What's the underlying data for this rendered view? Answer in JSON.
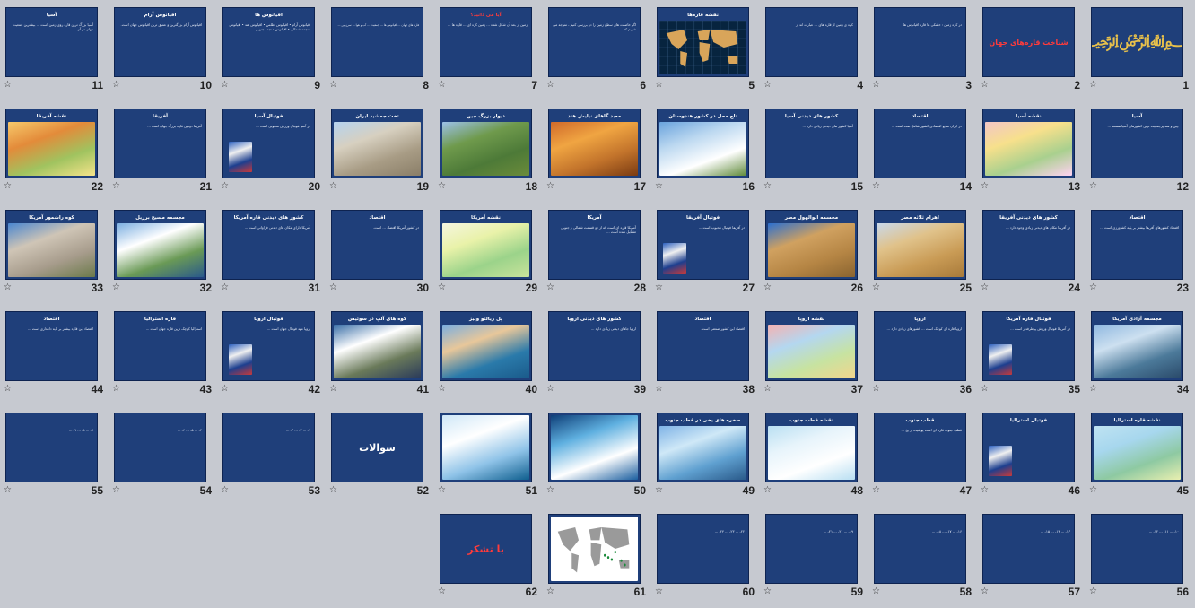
{
  "slides": [
    {
      "n": "1",
      "type": "calligraphy",
      "title": "بسم الله الرحمن الرحیم",
      "art": "gold-calligraphy"
    },
    {
      "n": "2",
      "type": "cover",
      "title": "شناخت قاره‌های جهان",
      "red": true
    },
    {
      "n": "3",
      "type": "text",
      "title": "",
      "body": "در کره زمین : خشکی ها قاره اقیانوس ها"
    },
    {
      "n": "4",
      "type": "text",
      "title": "",
      "body": "کره ی زمین از قاره های ... عبارت اند از"
    },
    {
      "n": "5",
      "type": "photo",
      "title": "نقشه قاره‌ها",
      "art": "world-map"
    },
    {
      "n": "6",
      "type": "text",
      "title": "",
      "red": true,
      "body": "اگر خاصیت های سطح زمین را در بررسی کنیم ، متوجه می شویم که ..."
    },
    {
      "n": "7",
      "type": "text",
      "title": "آیا می دانید؟",
      "red": true,
      "body": "زمین از بعد آن شکل شده ... زمین کره ای ... قاره ها ..."
    },
    {
      "n": "8",
      "type": "bigtext",
      "title": "",
      "body": "قاره های جهان ... اقیانوس ها ... جمعیت ... آب و هوا ... سرزمین ..."
    },
    {
      "n": "9",
      "type": "text",
      "title": "اقیانوس ها",
      "body": "اقیانوس آرام • اقیانوس اطلس • اقیانوس هند • اقیانوس منجمد شمالی • اقیانوس منجمد جنوبی"
    },
    {
      "n": "10",
      "type": "text",
      "title": "اقیانوس آرام",
      "body": "اقیانوس آرام بزرگترین و عمیق ترین اقیانوس جهان است."
    },
    {
      "n": "11",
      "type": "text",
      "title": "آسیا",
      "body": "آسیا بزرگ ترین قاره روی زمین است ... بیشترین جمعیت جهان در آن ..."
    },
    {
      "n": "12",
      "type": "text",
      "title": "آسیا",
      "body": "چین و هند پرجمعیت ترین کشورهای آسیا هستند ..."
    },
    {
      "n": "13",
      "type": "photo",
      "title": "نقشه آسیا",
      "art": "asia-map"
    },
    {
      "n": "14",
      "type": "text",
      "title": "اقتصاد",
      "body": "در ایران منابع اقتصادی کشور شامل نفت است ..."
    },
    {
      "n": "15",
      "type": "text",
      "title": "کشور های دیدنی آسیا",
      "body": "آسیا کشور های دیدنی زیادی دارد ..."
    },
    {
      "n": "16",
      "type": "photo",
      "title": "تاج محل در کشور هندوستان",
      "art": "taj-mahal"
    },
    {
      "n": "17",
      "type": "photo",
      "title": "معبد گاهای نیایش هند",
      "art": "golden-temple"
    },
    {
      "n": "18",
      "type": "photo",
      "title": "دیوار بزرگ چین",
      "art": "great-wall"
    },
    {
      "n": "19",
      "type": "photo",
      "title": "تخت جمشید ایران",
      "art": "persepolis"
    },
    {
      "n": "20",
      "type": "text-pic",
      "title": "فوتبال آسیا",
      "body": "در آسیا فوتبال ورزش محبوبی است ...",
      "art": "football-player"
    },
    {
      "n": "21",
      "type": "text",
      "title": "آفریقا",
      "body": "آفریقا دومین قاره بزرگ جهان است ..."
    },
    {
      "n": "22",
      "type": "photo",
      "title": "نقشه آفریقا",
      "art": "africa-map"
    },
    {
      "n": "23",
      "type": "text",
      "title": "اقتصاد",
      "body": "اقتصاد کشورهای آفریقا بیشتر بر پایه کشاورزی است ..."
    },
    {
      "n": "24",
      "type": "text",
      "title": "کشور های دیدنی آفریقا",
      "body": "در آفریقا مکان های دیدنی زیادی وجود دارد ..."
    },
    {
      "n": "25",
      "type": "photo",
      "title": "اهرام ثلاثه مصر",
      "art": "pyramids"
    },
    {
      "n": "26",
      "type": "photo",
      "title": "مجسمه ابوالهول مصر",
      "art": "sphinx"
    },
    {
      "n": "27",
      "type": "text-pic",
      "title": "فوتبال آفریقا",
      "body": "در آفریقا فوتبال محبوب است ...",
      "art": "football-player"
    },
    {
      "n": "28",
      "type": "text",
      "title": "آمریکا",
      "body": "آمریکا قاره ای است که از دو قسمت شمالی و جنوبی تشکیل شده است ..."
    },
    {
      "n": "29",
      "type": "photo",
      "title": "نقشه آمریکا",
      "art": "america-map"
    },
    {
      "n": "30",
      "type": "text",
      "title": "اقتصاد",
      "body": "در کشور آمریکا اقتصاد ... است."
    },
    {
      "n": "31",
      "type": "text",
      "title": "کشور های دیدنی قاره آمریکا",
      "body": "آمریکا دارای مکان های دیدنی فراوانی است ..."
    },
    {
      "n": "32",
      "type": "photo",
      "title": "مجسمه مسیح برزیل",
      "art": "rio"
    },
    {
      "n": "33",
      "type": "photo",
      "title": "کوه راشمور آمریکا",
      "art": "rushmore"
    },
    {
      "n": "34",
      "type": "photo",
      "title": "مجسمه آزادی آمریکا",
      "art": "liberty"
    },
    {
      "n": "35",
      "type": "text-pic",
      "title": "فوتبال قاره آمریکا",
      "body": "در آمریکا فوتبال ورزش پرطرفدار است ...",
      "art": "football-player"
    },
    {
      "n": "36",
      "type": "text",
      "title": "اروپا",
      "body": "اروپا قاره ای کوچک است ... کشورهای زیادی دارد ..."
    },
    {
      "n": "37",
      "type": "photo",
      "title": "نقشه اروپا",
      "art": "europe-map"
    },
    {
      "n": "38",
      "type": "text",
      "title": "اقتصاد",
      "body": "اقتصاد این کشور صنعتی است."
    },
    {
      "n": "39",
      "type": "text",
      "title": "کشور های دیدنی اروپا",
      "body": "اروپا جاهای دیدنی زیادی دارد ..."
    },
    {
      "n": "40",
      "type": "photo",
      "title": "پل ریالتو ونیز",
      "art": "venice"
    },
    {
      "n": "41",
      "type": "photo",
      "title": "کوه های آلپ در سوئیس",
      "art": "alps"
    },
    {
      "n": "42",
      "type": "text-pic",
      "title": "فوتبال اروپا",
      "body": "اروپا مهد فوتبال جهان است ...",
      "art": "football-player"
    },
    {
      "n": "43",
      "type": "text",
      "title": "قاره استرالیا",
      "body": "استرالیا کوچک ترین قاره جهان است ..."
    },
    {
      "n": "44",
      "type": "text",
      "title": "اقتصاد",
      "body": "اقتصاد این قاره بیشتر بر پایه دامداری است ..."
    },
    {
      "n": "45",
      "type": "photo",
      "title": "نقشه قاره استرالیا",
      "art": "oceania-map"
    },
    {
      "n": "46",
      "type": "text-pic",
      "title": "فوتبال استرالیا",
      "body": "",
      "art": "football-player"
    },
    {
      "n": "47",
      "type": "text",
      "title": "قطب جنوب",
      "body": "قطب جنوب قاره ای است پوشیده از یخ ..."
    },
    {
      "n": "48",
      "type": "photo",
      "title": "نقشه قطب جنوب",
      "art": "antarctica-map"
    },
    {
      "n": "49",
      "type": "photo",
      "title": "صخره های یخی در قطب جنوب",
      "art": "ice-cliffs"
    },
    {
      "n": "50",
      "type": "photo-full",
      "title": "",
      "art": "iceberg-blue"
    },
    {
      "n": "51",
      "type": "photo-full",
      "title": "",
      "art": "icebergs-kayak"
    },
    {
      "n": "52",
      "type": "big",
      "title": "سوالات"
    },
    {
      "n": "53",
      "type": "text",
      "title": "",
      "body": "۱- ... ۲- ... ۳- ..."
    },
    {
      "n": "54",
      "type": "text",
      "title": "",
      "body": "۴- ... ۵- ... ۶- ..."
    },
    {
      "n": "55",
      "type": "text",
      "title": "",
      "body": "۷- ... ۸- ... ۹- ..."
    },
    {
      "n": "56",
      "type": "text",
      "title": "",
      "body": "۱۰- ... ۱۱- ... ۱۲- ..."
    },
    {
      "n": "57",
      "type": "text",
      "title": "",
      "body": "۱۳- ... ۱۴- ... ۱۵- ..."
    },
    {
      "n": "58",
      "type": "text",
      "title": "",
      "body": "۱۶- ... ۱۷- ... ۱۸- ..."
    },
    {
      "n": "59",
      "type": "text",
      "title": "",
      "body": "۱۹- ... ۲۰- ... ۲۱- ..."
    },
    {
      "n": "60",
      "type": "text",
      "title": "",
      "body": "۲۲- ... ۲۳- ... ۲۴- ..."
    },
    {
      "n": "61",
      "type": "photo-full",
      "title": "",
      "art": "world-map-white"
    },
    {
      "n": "62",
      "type": "big",
      "title": "با تشکر",
      "red": true
    }
  ]
}
